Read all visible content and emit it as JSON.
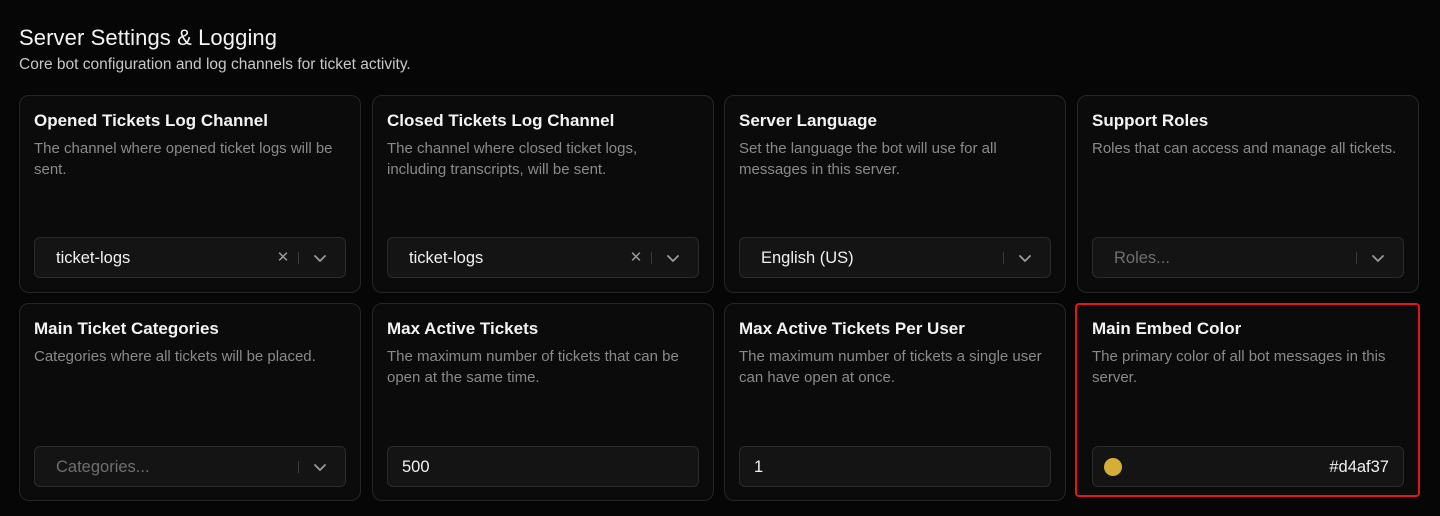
{
  "section": {
    "title": "Server Settings & Logging",
    "subtitle": "Core bot configuration and log channels for ticket activity."
  },
  "cards": {
    "opened_log": {
      "title": "Opened Tickets Log Channel",
      "description": "The channel where opened ticket logs will be sent.",
      "value": "ticket-logs"
    },
    "closed_log": {
      "title": "Closed Tickets Log Channel",
      "description": "The channel where closed ticket logs, including transcripts, will be sent.",
      "value": "ticket-logs"
    },
    "language": {
      "title": "Server Language",
      "description": "Set the language the bot will use for all messages in this server.",
      "value": "English (US)"
    },
    "support_roles": {
      "title": "Support Roles",
      "description": "Roles that can access and manage all tickets.",
      "placeholder": "Roles..."
    },
    "categories": {
      "title": "Main Ticket Categories",
      "description": "Categories where all tickets will be placed.",
      "placeholder": "Categories..."
    },
    "max_active": {
      "title": "Max Active Tickets",
      "description": "The maximum number of tickets that can be open at the same time.",
      "value": "500"
    },
    "max_per_user": {
      "title": "Max Active Tickets Per User",
      "description": "The maximum number of tickets a single user can have open at once.",
      "value": "1"
    },
    "embed_color": {
      "title": "Main Embed Color",
      "description": "The primary color of all bot messages in this server.",
      "value": "#d4af37"
    }
  },
  "icons": {
    "clear": "close-icon",
    "dropdown": "chevron-down-icon",
    "swatch": "color-swatch"
  },
  "colors": {
    "embed_swatch": "#d4af37",
    "highlight_border": "#e0161a",
    "background": "#060606"
  }
}
